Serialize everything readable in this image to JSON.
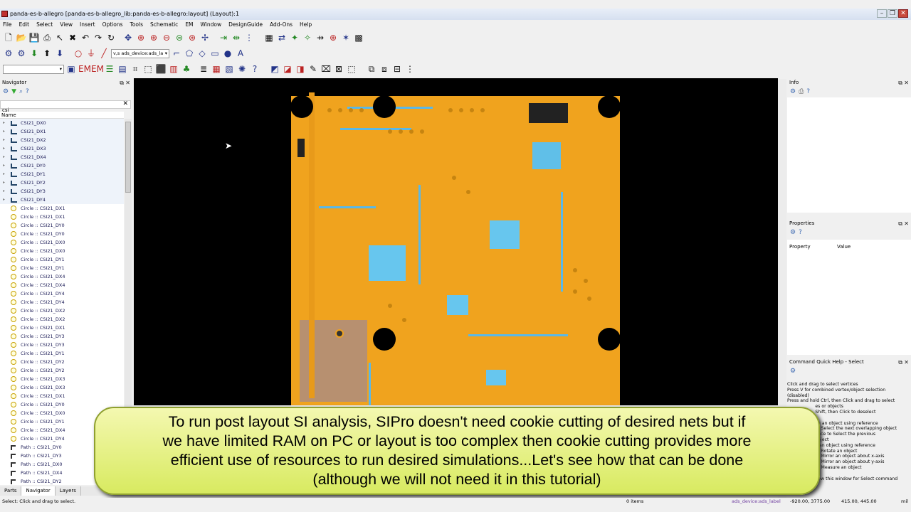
{
  "window": {
    "title": "panda-es-b-allegro [panda-es-b-allegro_lib:panda-es-b-allegro:layout] (Layout):1",
    "controls": [
      "–",
      "❐",
      "✕"
    ]
  },
  "menu": [
    "File",
    "Edit",
    "Select",
    "View",
    "Insert",
    "Options",
    "Tools",
    "Schematic",
    "EM",
    "Window",
    "DesignGuide",
    "Add-Ons",
    "Help"
  ],
  "toolbar2": {
    "layer_combo": "v,s ads_device:ads_la"
  },
  "navigator": {
    "title": "Navigator",
    "filter_value": "csi",
    "column_header": "Name",
    "nets": [
      "CSI21_DX0",
      "CSI21_DX1",
      "CSI21_DX2",
      "CSI21_DX3",
      "CSI21_DX4",
      "CSI21_DY0",
      "CSI21_DY1",
      "CSI21_DY2",
      "CSI21_DY3",
      "CSI21_DY4"
    ],
    "circles": [
      "Circle :: CSI21_DX1",
      "Circle :: CSI21_DX1",
      "Circle :: CSI21_DY0",
      "Circle :: CSI21_DY0",
      "Circle :: CSI21_DX0",
      "Circle :: CSI21_DX0",
      "Circle :: CSI21_DY1",
      "Circle :: CSI21_DY1",
      "Circle :: CSI21_DX4",
      "Circle :: CSI21_DX4",
      "Circle :: CSI21_DY4",
      "Circle :: CSI21_DY4",
      "Circle :: CSI21_DX2",
      "Circle :: CSI21_DX2",
      "Circle :: CSI21_DX1",
      "Circle :: CSI21_DY3",
      "Circle :: CSI21_DY3",
      "Circle :: CSI21_DY1",
      "Circle :: CSI21_DY2",
      "Circle :: CSI21_DY2",
      "Circle :: CSI21_DX3",
      "Circle :: CSI21_DX3",
      "Circle :: CSI21_DX1",
      "Circle :: CSI21_DY0",
      "Circle :: CSI21_DX0",
      "Circle :: CSI21_DY1",
      "Circle :: CSI21_DX4",
      "Circle :: CSI21_DY4"
    ],
    "paths": [
      "Path :: CSI21_DY0",
      "Path :: CSI21_DY3",
      "Path :: CSI21_DX0",
      "Path :: CSI21_DX4",
      "Path :: CSI21_DY2"
    ],
    "tabs": [
      "Parts",
      "Navigator",
      "Layers"
    ]
  },
  "info_panel": {
    "title": "Info"
  },
  "properties_panel": {
    "title": "Properties",
    "col_property": "Property",
    "col_value": "Value"
  },
  "quick_help": {
    "title": "Command Quick Help - Select",
    "lines": [
      "Click and drag to select vertices",
      "Press V for combined vertex/object selection",
      "(disabled)",
      "Press and hold Ctrl, then Click and drag to select",
      "                    es or objects",
      "                    Shift, then Click to deselect",
      "",
      "                    ve an object using reference",
      "                    to Select the next overlapping object",
      "                    pace to Select the previous",
      "                    object",
      "                    y an object using reference",
      "                    to Rotate an object",
      "                    to Mirror an object about x-axis",
      "                    to Mirror an object about y-axis",
      "                    to Measure an object",
      "",
      "                    how this window for Select command"
    ]
  },
  "caption": "To run post layout SI analysis, SIPro doesn't need cookie cutting of desired nets but if\nwe have limited RAM on PC or layout is too complex then cookie cutting provides more\nefficient use of resources to run desired simulations...Let's see how that can be done\n(although we will not need it in this tutorial)",
  "status": {
    "left": "Select: Click and drag to select.",
    "items": "0 items",
    "layer": "ads_device:ads_label",
    "coords": "-920.00, 3775.00",
    "coords2": "415.00, 445.00",
    "unit": "mil"
  },
  "colors": {
    "board": "#f0a31e",
    "copper": "#5ab8e8",
    "canvas_bg": "#000000",
    "caption_bg": "#e4ef80"
  }
}
